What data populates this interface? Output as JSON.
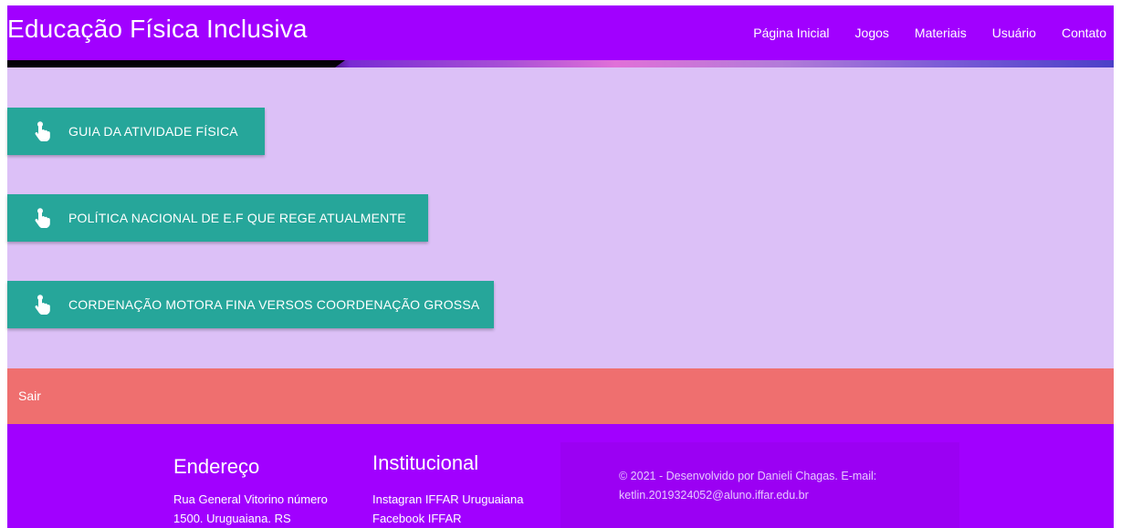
{
  "header": {
    "brand": "Educação Física Inclusiva",
    "nav": [
      "Página Inicial",
      "Jogos",
      "Materiais",
      "Usuário",
      "Contato"
    ]
  },
  "main": {
    "buttons": [
      {
        "label": "GUIA DA ATIVIDADE FÍSICA",
        "icon": "pointing-hand-icon"
      },
      {
        "label": "POLÍTICA NACIONAL DE E.F QUE REGE ATUALMENTE",
        "icon": "pointing-hand-icon"
      },
      {
        "label": "CORDENAÇÃO MOTORA FINA VERSOS COORDENAÇÃO GROSSA",
        "icon": "pointing-hand-icon"
      }
    ]
  },
  "sair": {
    "label": "Sair"
  },
  "footer": {
    "endereco": {
      "title": "Endereço",
      "line1": "Rua General Vitorino número",
      "line2": "1500. Uruguaiana. RS"
    },
    "institucional": {
      "title": "Institucional",
      "links": [
        "Instagran IFFAR Uruguaiana",
        "Facebook IFFAR"
      ]
    },
    "copyright": "© 2021 - Desenvolvido por Danieli Chagas. E-mail: ketlin.2019324052@aluno.iffar.edu.br"
  },
  "colors": {
    "header": "#a100ff",
    "main_bg": "#dcc0f7",
    "button": "#26a69a",
    "sair_bar": "#ef6f6f",
    "footer": "#a100ff"
  }
}
